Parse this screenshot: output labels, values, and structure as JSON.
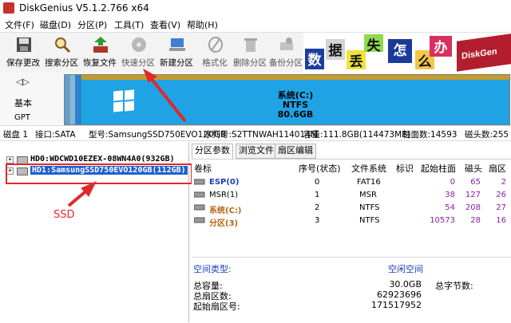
{
  "window": {
    "title": "DiskGenius V5.1.2.766 x64"
  },
  "menu": [
    "文件(F)",
    "磁盘(D)",
    "分区(P)",
    "工具(T)",
    "查看(V)",
    "帮助(H)"
  ],
  "toolbar": [
    {
      "label": "保存更改",
      "icon": "save-icon",
      "enabled": true
    },
    {
      "label": "搜索分区",
      "icon": "search-partition-icon",
      "enabled": true
    },
    {
      "label": "恢复文件",
      "icon": "recover-files-icon",
      "enabled": true
    },
    {
      "label": "快速分区",
      "icon": "quick-partition-icon",
      "enabled": false
    },
    {
      "label": "新建分区",
      "icon": "new-partition-icon",
      "enabled": true
    },
    {
      "label": "格式化",
      "icon": "format-icon",
      "enabled": false
    },
    {
      "label": "删除分区",
      "icon": "delete-partition-icon",
      "enabled": false
    },
    {
      "label": "备份分区",
      "icon": "backup-partition-icon",
      "enabled": false
    }
  ],
  "banner": {
    "chars": [
      "数",
      "据",
      "丢",
      "失",
      "怎",
      "么",
      "办"
    ],
    "brand": "DiskGen"
  },
  "diskmap": {
    "type_label": "基本",
    "scheme_label": "GPT",
    "main_partition": {
      "name": "系统(C:)",
      "fs": "NTFS",
      "size": "80.6GB"
    }
  },
  "diskinfo": {
    "disk": "磁盘 1",
    "interface": "接口:SATA",
    "model": "型号:SamsungSSD750EVO120GB",
    "serial": "序列号:S2TTNWAH114014M",
    "capacity": "容量:111.8GB(114473MB)",
    "cylinders": "柱面数:14593",
    "heads": "磁头数:255"
  },
  "tree": [
    {
      "label": "HD0:WDCWD10EZEX-08WN4A0(932GB)"
    },
    {
      "label": "HD1:SamsungSSD750EVO120GB(112GB)",
      "selected": true
    }
  ],
  "annotation": {
    "ssd_label": "SSD"
  },
  "tabs": [
    "分区参数",
    "浏览文件",
    "扇区编辑"
  ],
  "ptable": {
    "headers": [
      "卷标",
      "序号(状态)",
      "文件系统",
      "标识",
      "起始柱面",
      "磁头",
      "扇区"
    ],
    "rows": [
      {
        "label": "ESP(0)",
        "index": "0",
        "fs": "FAT16",
        "flag": "",
        "start_cyl": "0",
        "head": "65",
        "sector": "2",
        "style": "blue"
      },
      {
        "label": "MSR(1)",
        "index": "1",
        "fs": "MSR",
        "flag": "",
        "start_cyl": "38",
        "head": "127",
        "sector": "26",
        "style": "plain"
      },
      {
        "label": "系统(C:)",
        "index": "2",
        "fs": "NTFS",
        "flag": "",
        "start_cyl": "54",
        "head": "208",
        "sector": "27",
        "style": "orange"
      },
      {
        "label": "分区(3)",
        "index": "3",
        "fs": "NTFS",
        "flag": "",
        "start_cyl": "10573",
        "head": "28",
        "sector": "16",
        "style": "orange"
      }
    ]
  },
  "info": {
    "space_type_label": "空间类型:",
    "space_type_value": "空闲空间",
    "total_label": "总容量:",
    "total_value": "30.0GB",
    "total_bytes_label": "总字节数:",
    "sectors_label": "总扇区数:",
    "sectors_value": "62923696",
    "start_sector_label": "起始扇区号:",
    "start_sector_value": "171517952"
  },
  "colors": {
    "partition_blue": "#1fa3e5",
    "annotation_red": "#e0292b",
    "selected_blue": "#1e5fd0",
    "purple_text": "#8a1fa0"
  }
}
